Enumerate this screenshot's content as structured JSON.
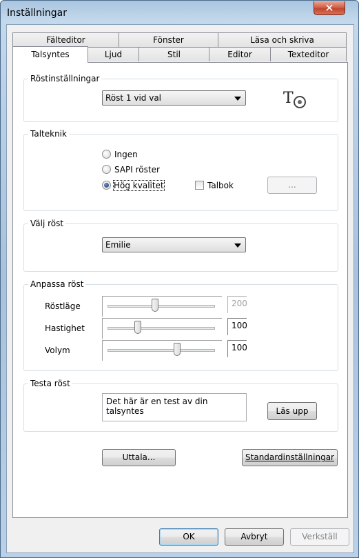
{
  "window": {
    "title": "Inställningar",
    "close_glyph": "✕"
  },
  "tabs_back": [
    "Fälteditor",
    "Fönster",
    "Läsa och skriva"
  ],
  "tabs_front": [
    "Talsyntes",
    "Ljud",
    "Stil",
    "Editor",
    "Texteditor"
  ],
  "active_tab": "Talsyntes",
  "groups": {
    "rost": {
      "label": "Röstinställningar",
      "combo_value": "Röst 1 vid val",
      "logo_icon": "tts-logo-icon"
    },
    "talteknik": {
      "label": "Talteknik",
      "options": [
        "Ingen",
        "SAPI röster",
        "Hög kvalitet"
      ],
      "selected": "Hög kvalitet",
      "talbok_label": "Talbok",
      "talbok_checked": false,
      "browse_label": "..."
    },
    "valj": {
      "label": "Välj röst",
      "combo_value": "Emilie"
    },
    "anpassa": {
      "label": "Anpassa röst",
      "rows": [
        {
          "label": "Röstläge",
          "value": "200",
          "level": 0.43,
          "enabled": false
        },
        {
          "label": "Hastighet",
          "value": "100",
          "level": 0.26,
          "enabled": true
        },
        {
          "label": "Volym",
          "value": "100",
          "level": 0.65,
          "enabled": true
        }
      ]
    },
    "testa": {
      "label": "Testa röst",
      "text": "Det här är en test av din talsyntes",
      "read_button": "Läs upp"
    }
  },
  "buttons": {
    "uttala": "Uttala...",
    "standard": "Standardinställningar"
  },
  "footer": {
    "ok": "OK",
    "cancel": "Avbryt",
    "apply": "Verkställ"
  }
}
